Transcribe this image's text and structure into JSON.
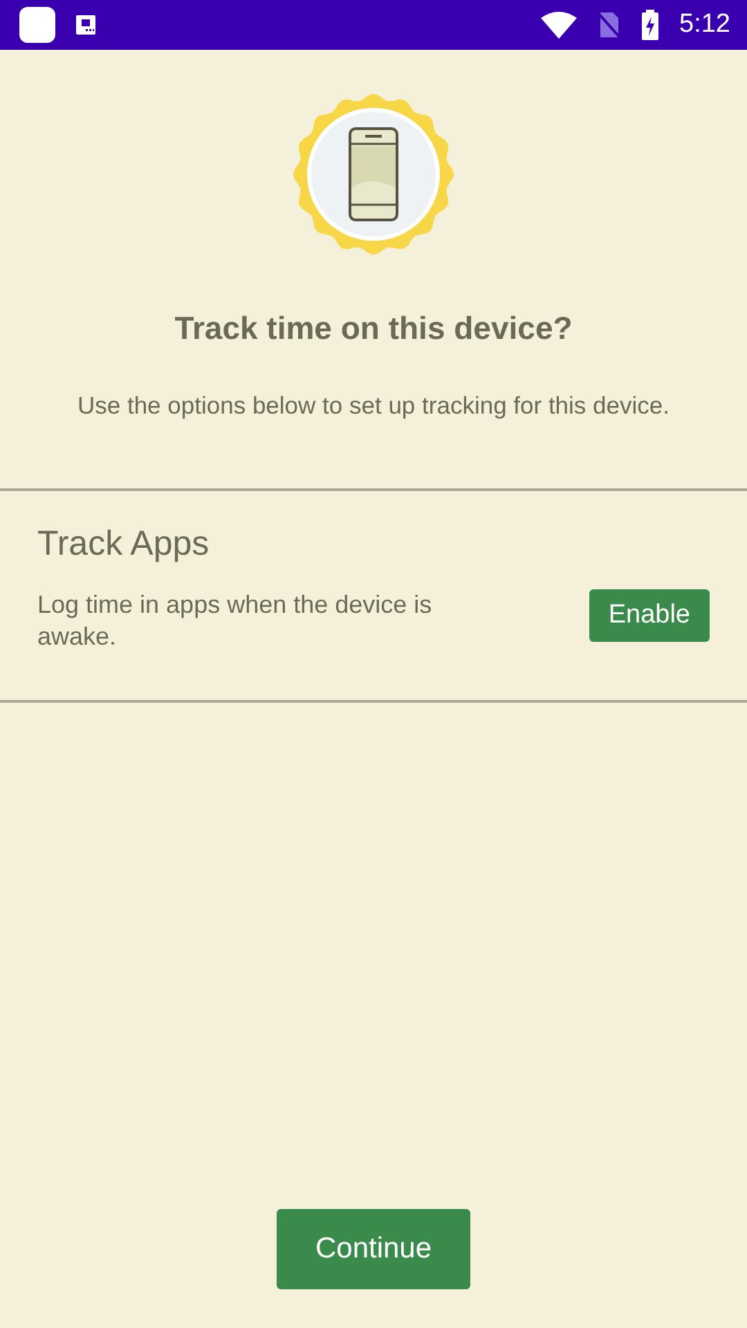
{
  "status_bar": {
    "time": "5:12"
  },
  "title": "Track time on this device?",
  "subtitle": "Use the options below to set up tracking for this device.",
  "options": [
    {
      "title": "Track Apps",
      "description": "Log time in apps when the device is awake.",
      "button": "Enable"
    }
  ],
  "continue_button": "Continue"
}
